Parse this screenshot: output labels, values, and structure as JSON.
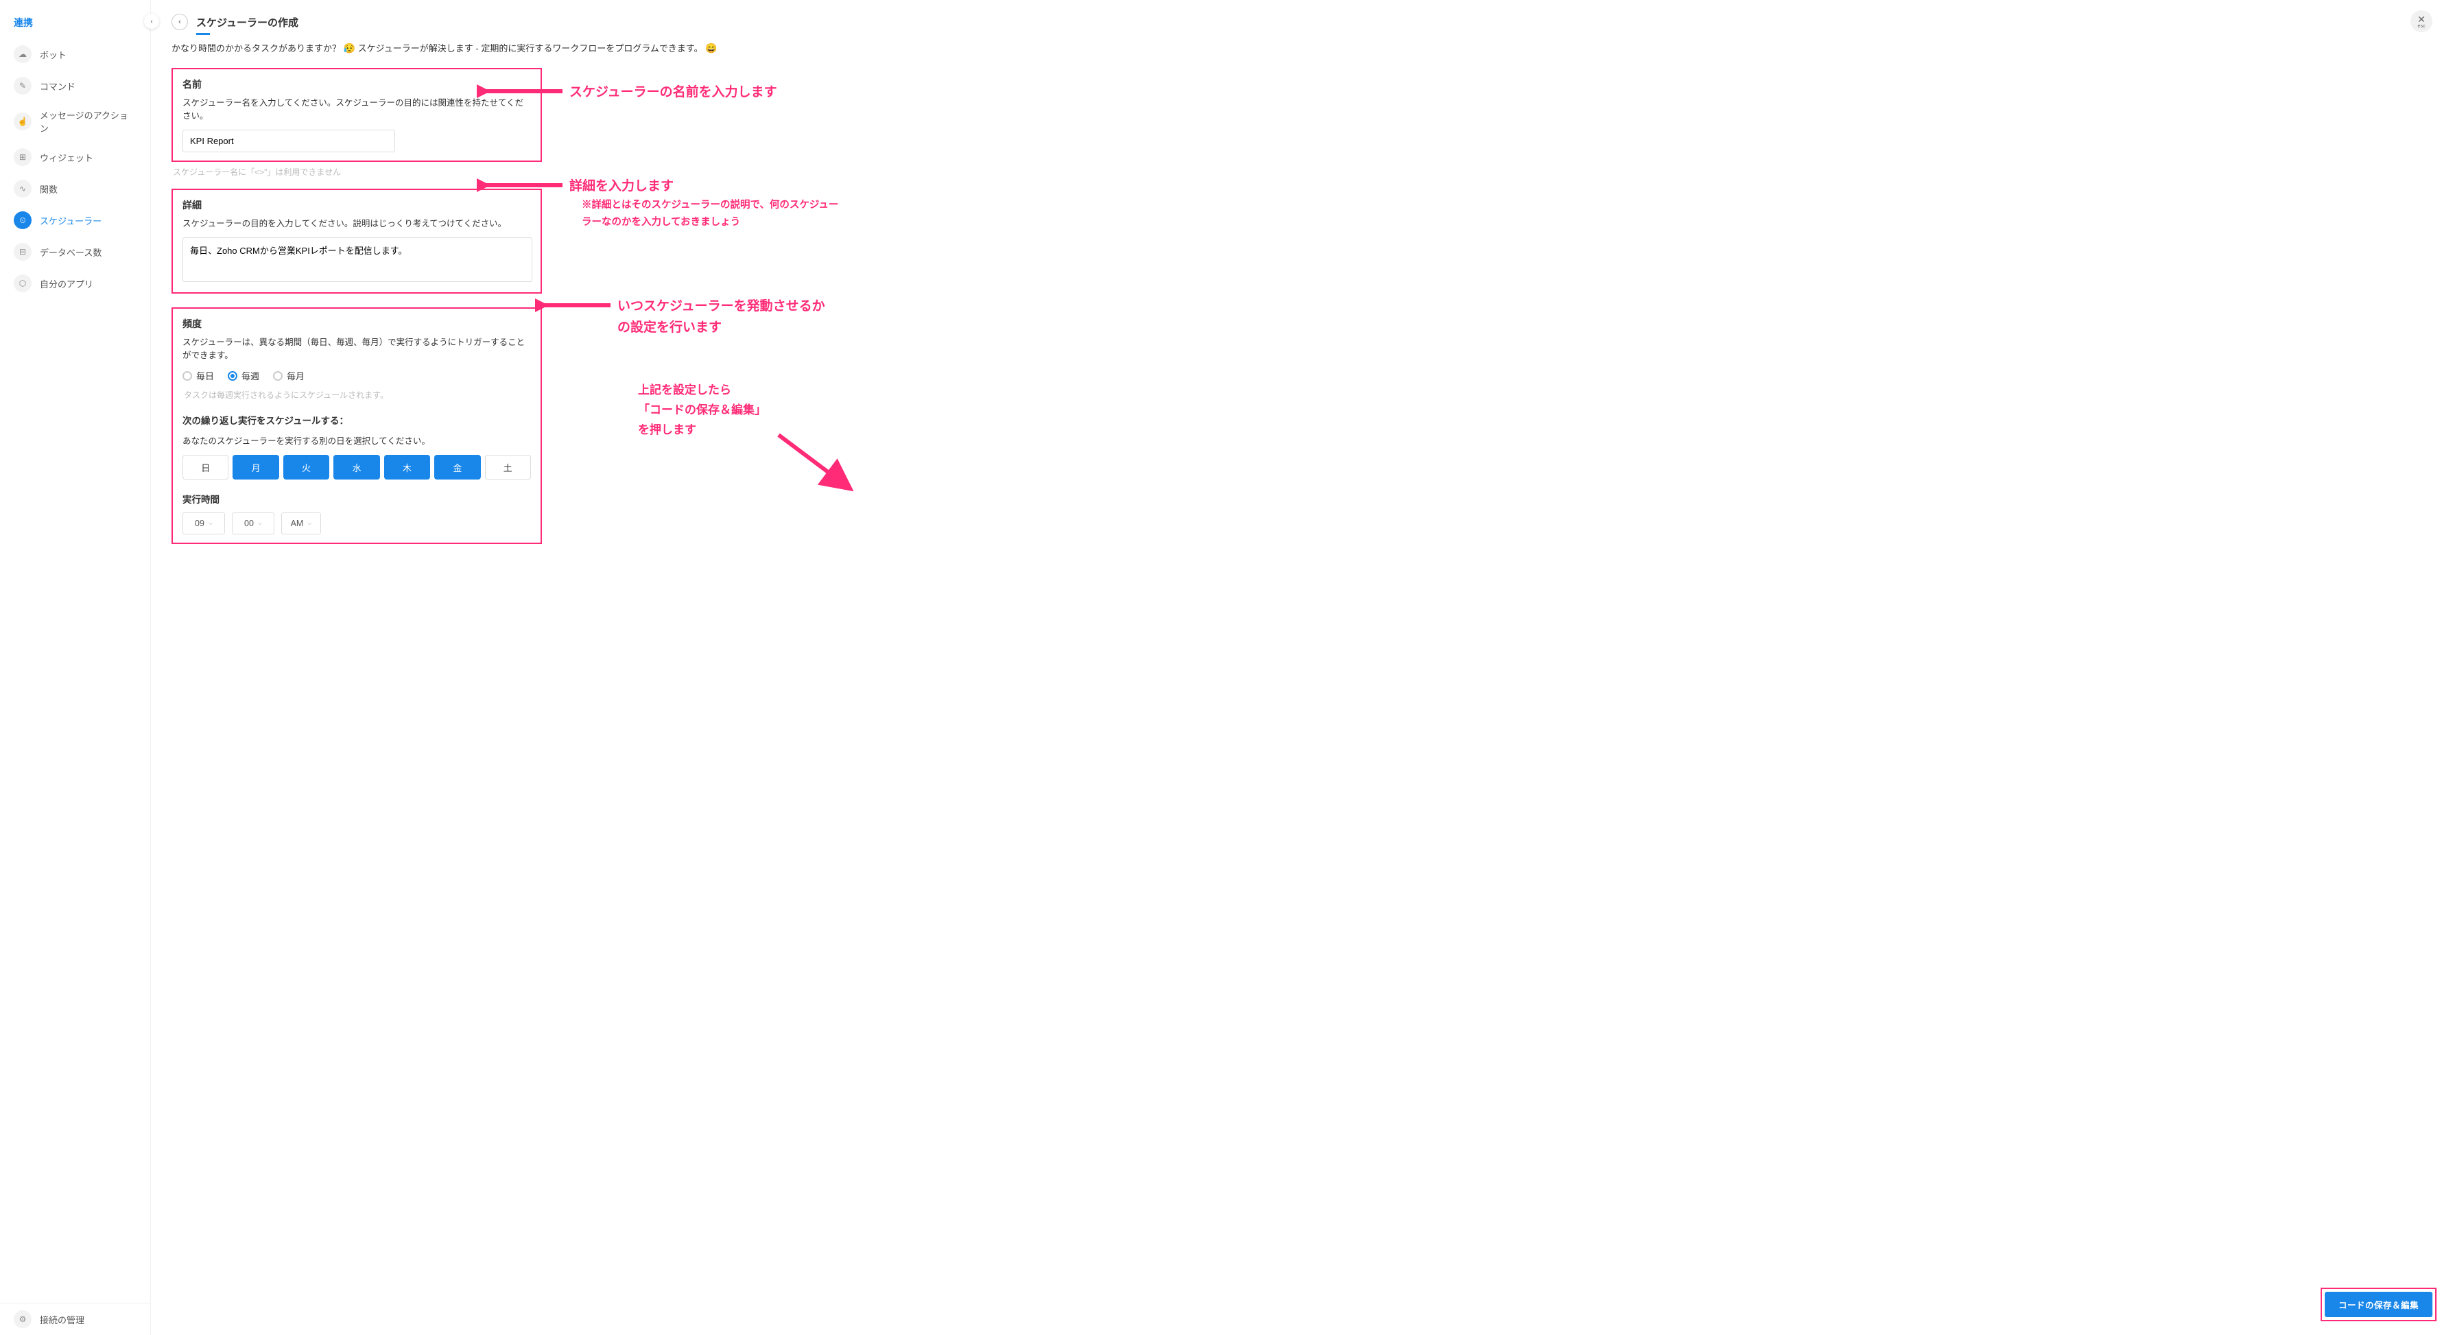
{
  "sidebar": {
    "title": "連携",
    "items": [
      {
        "icon": "☁",
        "label": "ボット"
      },
      {
        "icon": "✎",
        "label": "コマンド"
      },
      {
        "icon": "☝",
        "label": "メッセージのアクション"
      },
      {
        "icon": "⊞",
        "label": "ウィジェット"
      },
      {
        "icon": "∿",
        "label": "関数"
      },
      {
        "icon": "⏲",
        "label": "スケジューラー",
        "active": true
      },
      {
        "icon": "⊟",
        "label": "データベース数"
      },
      {
        "icon": "⬡",
        "label": "自分のアプリ"
      }
    ],
    "footer": {
      "icon": "⚙",
      "label": "接続の管理"
    }
  },
  "header": {
    "title": "スケジューラーの作成",
    "close_label": "esc"
  },
  "subtitle": {
    "part1": "かなり時間のかかるタスクがありますか？ ",
    "emoji1": "😥",
    "part2": " スケジューラーが解決します - 定期的に実行するワークフローをプログラムできます。 ",
    "emoji2": "😄"
  },
  "name_section": {
    "label": "名前",
    "desc": "スケジューラー名を入力してください。スケジューラーの目的には関連性を持たせてください。",
    "value": "KPI Report",
    "hint": "スケジューラー名に「<>\"」は利用できません"
  },
  "detail_section": {
    "label": "詳細",
    "desc": "スケジューラーの目的を入力してください。説明はじっくり考えてつけてください。",
    "value": "毎日、Zoho CRMから営業KPIレポートを配信します。"
  },
  "freq_section": {
    "label": "頻度",
    "desc": "スケジューラーは、異なる期間（毎日、毎週、毎月）で実行するようにトリガーすることができます。",
    "options": [
      "毎日",
      "毎週",
      "毎月"
    ],
    "selected": "毎週",
    "hint": "タスクは毎週実行されるようにスケジュールされます。",
    "repeat_label": "次の繰り返し実行をスケジュールする：",
    "repeat_desc": "あなたのスケジューラーを実行する別の日を選択してください。",
    "days": [
      {
        "label": "日",
        "selected": false
      },
      {
        "label": "月",
        "selected": true
      },
      {
        "label": "火",
        "selected": true
      },
      {
        "label": "水",
        "selected": true
      },
      {
        "label": "木",
        "selected": true
      },
      {
        "label": "金",
        "selected": true
      },
      {
        "label": "土",
        "selected": false
      }
    ],
    "time_label": "実行時間",
    "hour": "09",
    "minute": "00",
    "ampm": "AM"
  },
  "annotations": {
    "a1": "スケジューラーの名前を入力します",
    "a2_main": "詳細を入力します",
    "a2_sub": "※詳細とはそのスケジューラーの説明で、何のスケジューラーなのかを入力しておきましょう",
    "a3_line1": "いつスケジューラーを発動させるか",
    "a3_line2": "の設定を行います",
    "a4_line1": "上記を設定したら",
    "a4_line2": "「コードの保存＆編集」",
    "a4_line3": "を押します"
  },
  "save_button": "コードの保存＆編集"
}
